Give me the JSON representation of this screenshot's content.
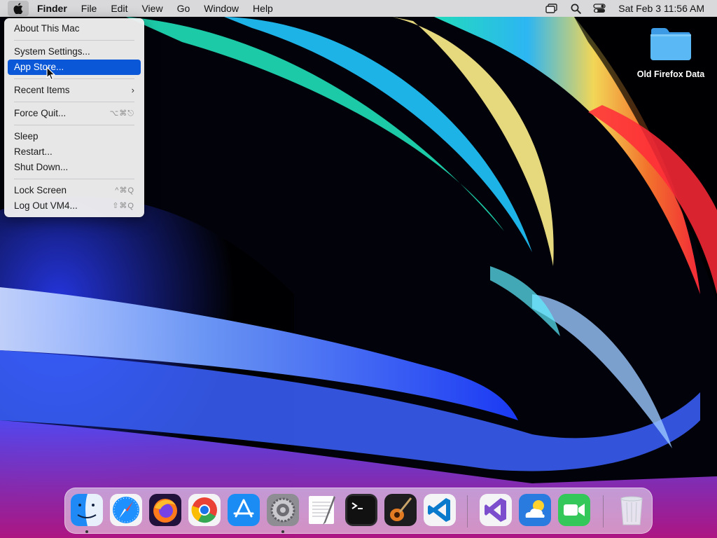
{
  "menubar": {
    "app_name": "Finder",
    "menus": [
      "File",
      "Edit",
      "View",
      "Go",
      "Window",
      "Help"
    ],
    "clock": "Sat Feb 3  11:56 AM",
    "status_icons": [
      "screen-mirroring-icon",
      "spotlight-search-icon",
      "control-center-icon"
    ]
  },
  "apple_menu": {
    "items": [
      {
        "label": "About This Mac"
      },
      {
        "label": "System Settings..."
      },
      {
        "label": "App Store...",
        "selected": true
      },
      {
        "label": "Recent Items",
        "submenu": true
      },
      {
        "label": "Force Quit...",
        "shortcut": "⌥⌘⎋"
      },
      {
        "label": "Sleep"
      },
      {
        "label": "Restart..."
      },
      {
        "label": "Shut Down..."
      },
      {
        "label": "Lock Screen",
        "shortcut": "^⌘Q"
      },
      {
        "label": "Log Out VM4...",
        "shortcut": "⇧⌘Q"
      }
    ]
  },
  "desktop": {
    "folder_label": "Old Firefox Data"
  },
  "dock": {
    "apps": [
      "Finder",
      "Safari",
      "Firefox",
      "Chrome",
      "App Store",
      "System Settings",
      "TextEdit",
      "Terminal",
      "GarageBand",
      "Visual Studio Code",
      "Visual Studio",
      "Weather",
      "FaceTime",
      "Trash"
    ],
    "running": [
      "Finder",
      "System Settings"
    ]
  },
  "colors": {
    "selection": "#0a58d8",
    "folder": "#5ab8f5"
  }
}
